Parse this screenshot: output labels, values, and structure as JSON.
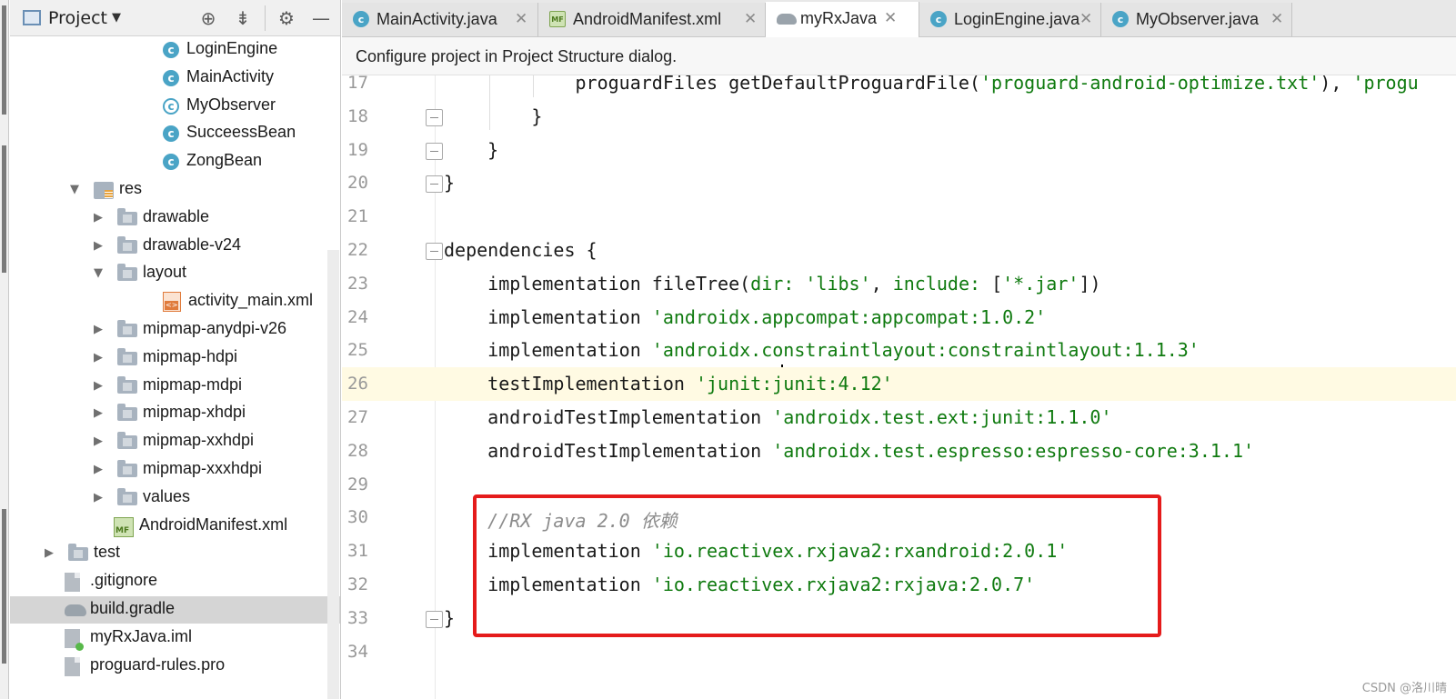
{
  "project_panel": {
    "title": "Project",
    "header_icons": [
      "locate-icon",
      "collapse-all-icon",
      "gear-icon",
      "minimize-icon"
    ],
    "tree": [
      {
        "label": "LoginEngine",
        "type": "class",
        "expanded": null
      },
      {
        "label": "MainActivity",
        "type": "class",
        "expanded": null
      },
      {
        "label": "MyObserver",
        "type": "abstract-class",
        "expanded": null
      },
      {
        "label": "SucceessBean",
        "type": "class",
        "expanded": null
      },
      {
        "label": "ZongBean",
        "type": "class",
        "expanded": null
      },
      {
        "label": "res",
        "type": "res-folder",
        "expanded": true
      },
      {
        "label": "drawable",
        "type": "folder",
        "expanded": false
      },
      {
        "label": "drawable-v24",
        "type": "folder",
        "expanded": false
      },
      {
        "label": "layout",
        "type": "folder",
        "expanded": true
      },
      {
        "label": "activity_main.xml",
        "type": "xml",
        "expanded": null
      },
      {
        "label": "mipmap-anydpi-v26",
        "type": "folder",
        "expanded": false
      },
      {
        "label": "mipmap-hdpi",
        "type": "folder",
        "expanded": false
      },
      {
        "label": "mipmap-mdpi",
        "type": "folder",
        "expanded": false
      },
      {
        "label": "mipmap-xhdpi",
        "type": "folder",
        "expanded": false
      },
      {
        "label": "mipmap-xxhdpi",
        "type": "folder",
        "expanded": false
      },
      {
        "label": "mipmap-xxxhdpi",
        "type": "folder",
        "expanded": false
      },
      {
        "label": "values",
        "type": "folder",
        "expanded": false
      },
      {
        "label": "AndroidManifest.xml",
        "type": "manifest",
        "expanded": null
      },
      {
        "label": "test",
        "type": "folder",
        "expanded": false
      },
      {
        "label": ".gitignore",
        "type": "file",
        "expanded": null
      },
      {
        "label": "build.gradle",
        "type": "gradle",
        "expanded": null,
        "selected": true
      },
      {
        "label": "myRxJava.iml",
        "type": "iml",
        "expanded": null
      },
      {
        "label": "proguard-rules.pro",
        "type": "file",
        "expanded": null
      }
    ]
  },
  "tabs": [
    {
      "label": "MainActivity.java",
      "icon": "class-icon",
      "active": false
    },
    {
      "label": "AndroidManifest.xml",
      "icon": "manifest-icon",
      "active": false
    },
    {
      "label": "myRxJava",
      "icon": "gradle-icon",
      "active": true
    },
    {
      "label": "LoginEngine.java",
      "icon": "class-icon",
      "active": false
    },
    {
      "label": "MyObserver.java",
      "icon": "class-icon",
      "active": false
    }
  ],
  "notification": "Configure project in Project Structure dialog.",
  "editor": {
    "lines": [
      {
        "n": "17",
        "segments": [
          {
            "t": "            proguardFiles getDefaultProguardFile(",
            "c": "kw"
          },
          {
            "t": "'proguard-android-optimize.txt'",
            "c": "str"
          },
          {
            "t": "), ",
            "c": "kw"
          },
          {
            "t": "'progu",
            "c": "str"
          }
        ]
      },
      {
        "n": "18",
        "segments": [
          {
            "t": "        }",
            "c": "kw"
          }
        ]
      },
      {
        "n": "19",
        "segments": [
          {
            "t": "    }",
            "c": "kw"
          }
        ]
      },
      {
        "n": "20",
        "segments": [
          {
            "t": "}",
            "c": "kw"
          }
        ]
      },
      {
        "n": "21",
        "segments": []
      },
      {
        "n": "22",
        "segments": [
          {
            "t": "dependencies {",
            "c": "kw"
          }
        ]
      },
      {
        "n": "23",
        "segments": [
          {
            "t": "    implementation fileTree(",
            "c": "kw"
          },
          {
            "t": "dir: ",
            "c": "param"
          },
          {
            "t": "'libs'",
            "c": "str"
          },
          {
            "t": ", ",
            "c": "kw"
          },
          {
            "t": "include: ",
            "c": "param"
          },
          {
            "t": "[",
            "c": "kw"
          },
          {
            "t": "'*.jar'",
            "c": "str"
          },
          {
            "t": "])",
            "c": "kw"
          }
        ]
      },
      {
        "n": "24",
        "segments": [
          {
            "t": "    implementation ",
            "c": "kw"
          },
          {
            "t": "'androidx.appcompat:appcompat:1.0.2'",
            "c": "str"
          }
        ]
      },
      {
        "n": "25",
        "segments": [
          {
            "t": "    implementation ",
            "c": "kw"
          },
          {
            "t": "'androidx.constraintlayout:constraintlayout:1.1.3'",
            "c": "str"
          }
        ]
      },
      {
        "n": "26",
        "segments": [
          {
            "t": "    testImplementation ",
            "c": "kw"
          },
          {
            "t": "'junit:junit:4.12'",
            "c": "str"
          }
        ],
        "current": true
      },
      {
        "n": "27",
        "segments": [
          {
            "t": "    androidTestImplementation ",
            "c": "kw"
          },
          {
            "t": "'androidx.test.ext:junit:1.1.0'",
            "c": "str"
          }
        ]
      },
      {
        "n": "28",
        "segments": [
          {
            "t": "    androidTestImplementation ",
            "c": "kw"
          },
          {
            "t": "'androidx.test.espresso:espresso-core:3.1.1'",
            "c": "str"
          }
        ]
      },
      {
        "n": "29",
        "segments": []
      },
      {
        "n": "30",
        "segments": [
          {
            "t": "    //RX java 2.0 依赖",
            "c": "cmt"
          }
        ]
      },
      {
        "n": "31",
        "segments": [
          {
            "t": "    implementation ",
            "c": "kw"
          },
          {
            "t": "'io.reactivex.rxjava2:rxandroid:2.0.1'",
            "c": "str"
          }
        ]
      },
      {
        "n": "32",
        "segments": [
          {
            "t": "    implementation ",
            "c": "kw"
          },
          {
            "t": "'io.reactivex.rxjava2:rxjava:2.0.7'",
            "c": "str"
          }
        ]
      },
      {
        "n": "33",
        "segments": [
          {
            "t": "}",
            "c": "kw"
          }
        ]
      },
      {
        "n": "34",
        "segments": []
      }
    ]
  },
  "annotation": {
    "color": "#e51b1b"
  },
  "watermark": "CSDN @洛川晴"
}
